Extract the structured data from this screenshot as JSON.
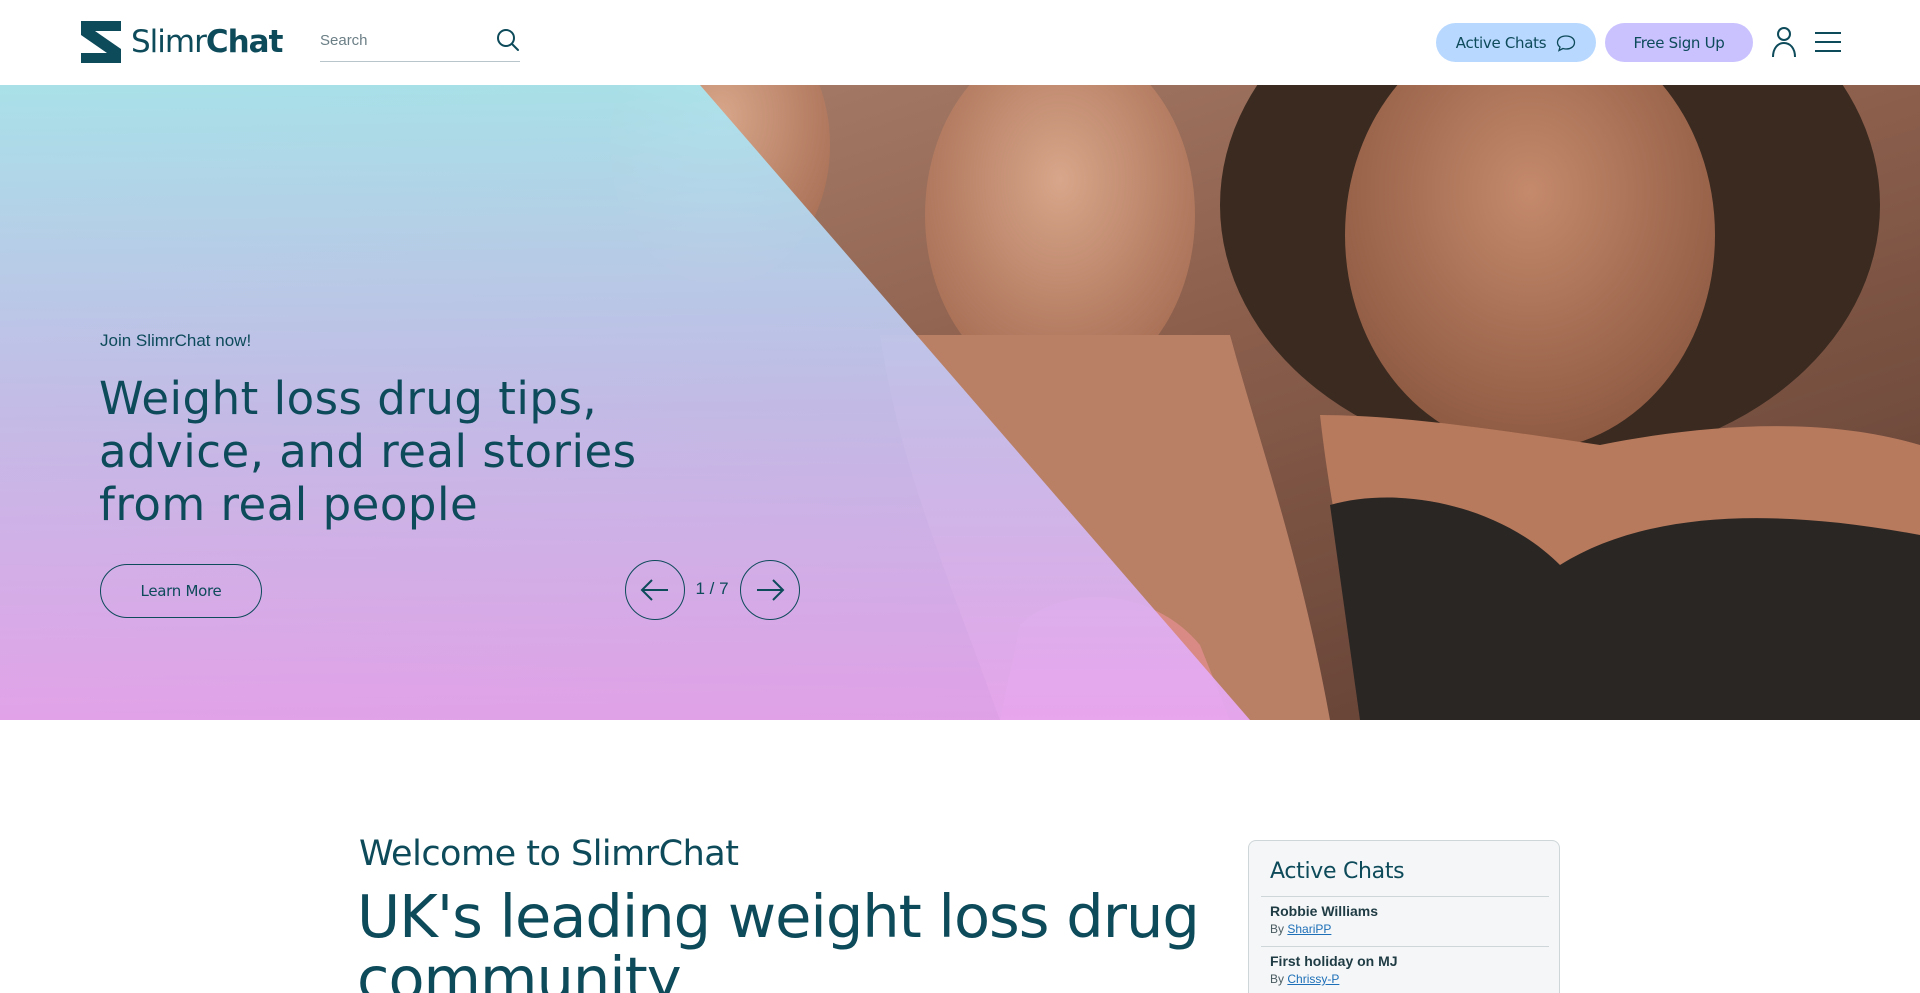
{
  "header": {
    "logo_light": "Slimr",
    "logo_bold": "Chat",
    "search_placeholder": "Search",
    "active_chats_label": "Active Chats",
    "signup_label": "Free Sign Up"
  },
  "hero": {
    "kicker": "Join SlimrChat now!",
    "title": "Weight loss drug tips, advice, and real stories from real people",
    "cta_label": "Learn More",
    "counter": "1 / 7"
  },
  "welcome": {
    "subtitle": "Welcome to SlimrChat",
    "title": "UK's leading weight loss drug community"
  },
  "active_chats": {
    "title": "Active Chats",
    "items": [
      {
        "title": "Robbie Williams",
        "by_prefix": "By",
        "author": "ShariPP"
      },
      {
        "title": "First holiday on MJ",
        "by_prefix": "By",
        "author": "Chrissy-P"
      }
    ]
  },
  "colors": {
    "brand_teal": "#0d4a5a",
    "active_chats_pill": "#b8d8ff",
    "signup_pill": "#c9c2ff",
    "hero_gradient_top": "#a8e8f2",
    "hero_gradient_bottom": "#e9a8f5"
  },
  "icons": {
    "search": "search-icon",
    "chat": "chat-bubble-icon",
    "user": "user-icon",
    "menu": "hamburger-menu-icon",
    "prev": "arrow-left-icon",
    "next": "arrow-right-icon",
    "logo": "slimrchat-logo-mark"
  }
}
